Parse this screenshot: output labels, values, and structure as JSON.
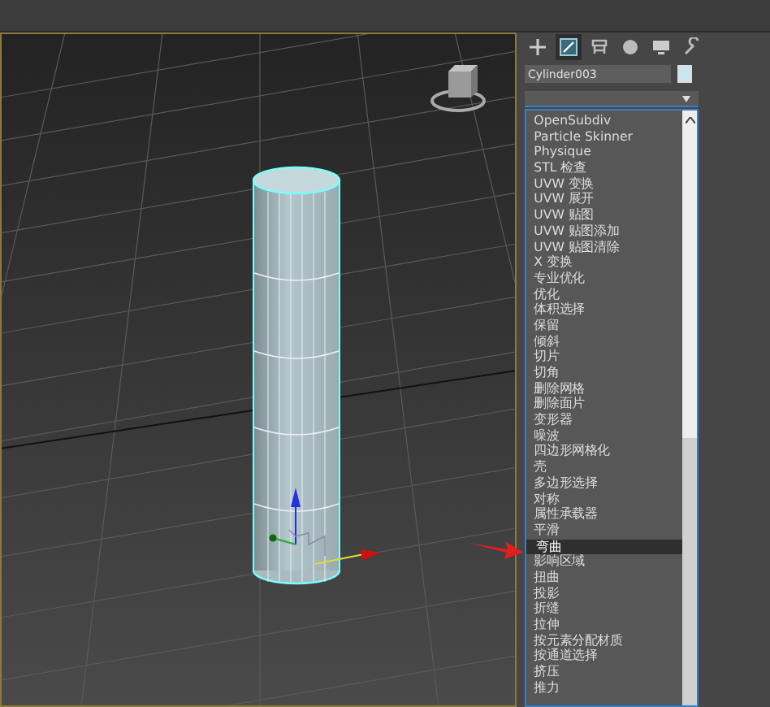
{
  "command_panel": {
    "tabs": [
      {
        "selected": false
      },
      {
        "selected": true
      },
      {
        "selected": false
      },
      {
        "selected": false
      },
      {
        "selected": false
      },
      {
        "selected": false
      }
    ]
  },
  "object_name": {
    "value": "Cylinder003"
  },
  "modifier_list": {
    "expanded": true,
    "items": [
      {
        "label": "OpenSubdiv",
        "selected": false
      },
      {
        "label": "Particle Skinner",
        "selected": false
      },
      {
        "label": "Physique",
        "selected": false
      },
      {
        "label": "STL 检查",
        "selected": false
      },
      {
        "label": "UVW 变换",
        "selected": false
      },
      {
        "label": "UVW 展开",
        "selected": false
      },
      {
        "label": "UVW 贴图",
        "selected": false
      },
      {
        "label": "UVW 贴图添加",
        "selected": false
      },
      {
        "label": "UVW 贴图清除",
        "selected": false
      },
      {
        "label": "X 变换",
        "selected": false
      },
      {
        "label": "专业优化",
        "selected": false
      },
      {
        "label": "优化",
        "selected": false
      },
      {
        "label": "体积选择",
        "selected": false
      },
      {
        "label": "保留",
        "selected": false
      },
      {
        "label": "倾斜",
        "selected": false
      },
      {
        "label": "切片",
        "selected": false
      },
      {
        "label": "切角",
        "selected": false
      },
      {
        "label": "删除网格",
        "selected": false
      },
      {
        "label": "删除面片",
        "selected": false
      },
      {
        "label": "变形器",
        "selected": false
      },
      {
        "label": "噪波",
        "selected": false
      },
      {
        "label": "四边形网格化",
        "selected": false
      },
      {
        "label": "壳",
        "selected": false
      },
      {
        "label": "多边形选择",
        "selected": false
      },
      {
        "label": "对称",
        "selected": false
      },
      {
        "label": "属性承载器",
        "selected": false
      },
      {
        "label": "平滑",
        "selected": false
      },
      {
        "label": "弯曲",
        "selected": true
      },
      {
        "label": "影响区域",
        "selected": false
      },
      {
        "label": "扭曲",
        "selected": false
      },
      {
        "label": "投影",
        "selected": false
      },
      {
        "label": "折缝",
        "selected": false
      },
      {
        "label": "拉伸",
        "selected": false
      },
      {
        "label": "按元素分配材质",
        "selected": false
      },
      {
        "label": "按通道选择",
        "selected": false
      },
      {
        "label": "挤压",
        "selected": false
      },
      {
        "label": "推力",
        "selected": false
      }
    ]
  }
}
